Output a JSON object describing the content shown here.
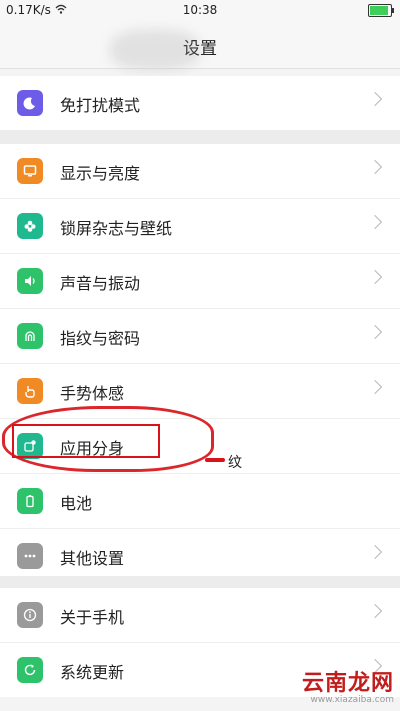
{
  "status": {
    "speed": "0.17K/s",
    "time": "10:38"
  },
  "header": {
    "title": "设置"
  },
  "groups": [
    [
      {
        "label": "免打扰模式",
        "icon": "moon-icon",
        "color": "#6c5ce7"
      }
    ],
    [
      {
        "label": "显示与亮度",
        "icon": "display-icon",
        "color": "#f08a24"
      },
      {
        "label": "锁屏杂志与壁纸",
        "icon": "flower-icon",
        "color": "#1fb88f"
      },
      {
        "label": "声音与振动",
        "icon": "speaker-icon",
        "color": "#2ec36a"
      },
      {
        "label": "指纹与密码",
        "icon": "fingerprint-icon",
        "color": "#2ec36a"
      },
      {
        "label": "手势体感",
        "icon": "hand-icon",
        "color": "#f08a24"
      },
      {
        "label": "应用分身",
        "icon": "app-clone-icon",
        "color": "#1fb88f"
      },
      {
        "label": "电池",
        "icon": "battery-icon",
        "color": "#2ec36a"
      },
      {
        "label": "其他设置",
        "icon": "more-icon",
        "color": "#9a9a9a"
      }
    ],
    [
      {
        "label": "关于手机",
        "icon": "info-icon",
        "color": "#9a9a9a"
      },
      {
        "label": "系统更新",
        "icon": "update-icon",
        "color": "#2ec36a"
      }
    ]
  ],
  "overlay": {
    "stray_text": "纹"
  },
  "watermark": {
    "brand": "云南龙网",
    "url": "www.xiazaiba.com"
  }
}
